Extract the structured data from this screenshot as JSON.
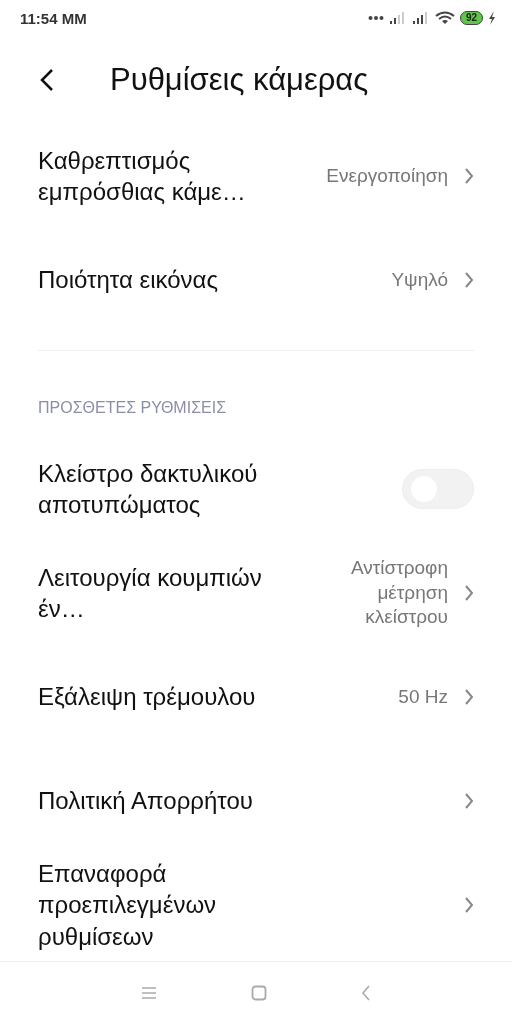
{
  "status_bar": {
    "time": "11:54 MM",
    "battery": "92"
  },
  "header": {
    "title": "Ρυθμίσεις κάμερας"
  },
  "sections": [
    {
      "items": [
        {
          "kind": "nav",
          "title": "Καθρεπτισμός εμπρόσθιας κάμε…",
          "value": "Ενεργοποίηση"
        },
        {
          "kind": "nav",
          "title": "Ποιότητα εικόνας",
          "value": "Υψηλό"
        }
      ]
    },
    {
      "heading": "ΠΡΟΣΘΕΤΕΣ ΡΥΘΜΙΣΕΙΣ",
      "items": [
        {
          "kind": "toggle",
          "title": "Κλείστρο δακτυλικού αποτυπώματος",
          "on": false
        },
        {
          "kind": "nav",
          "title": "Λειτουργία κουμπιών έν…",
          "value": "Αντίστροφη μέτρηση κλείστρου"
        },
        {
          "kind": "nav",
          "title": "Εξάλειψη τρέμουλου",
          "value": "50 Hz"
        },
        {
          "kind": "nav",
          "title": "Πολιτική Απορρήτου"
        },
        {
          "kind": "nav",
          "title": "Επαναφορά προεπιλεγμένων ρυθμίσεων"
        }
      ]
    }
  ]
}
